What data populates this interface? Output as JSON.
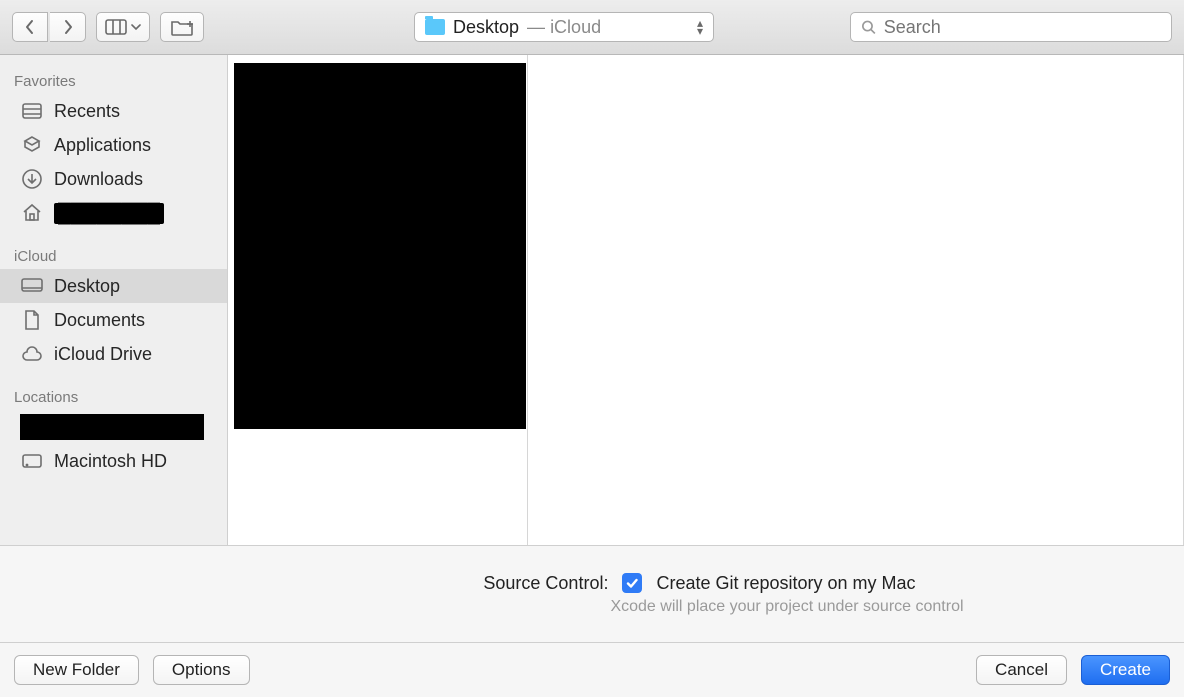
{
  "toolbar": {
    "path": {
      "name": "Desktop",
      "location": "iCloud"
    },
    "search_placeholder": "Search"
  },
  "sidebar": {
    "sections": [
      {
        "title": "Favorites",
        "items": [
          {
            "id": "recents",
            "label": "Recents",
            "icon": "recents"
          },
          {
            "id": "applications",
            "label": "Applications",
            "icon": "applications"
          },
          {
            "id": "downloads",
            "label": "Downloads",
            "icon": "downloads"
          },
          {
            "id": "home-hidden",
            "label": "",
            "icon": "house",
            "label_redacted": true
          }
        ]
      },
      {
        "title": "iCloud",
        "items": [
          {
            "id": "desktop",
            "label": "Desktop",
            "icon": "desktop",
            "selected": true
          },
          {
            "id": "documents",
            "label": "Documents",
            "icon": "document"
          },
          {
            "id": "icloud",
            "label": "iCloud Drive",
            "icon": "cloud"
          }
        ]
      },
      {
        "title": "Locations",
        "leading_redacted_block": true,
        "items": [
          {
            "id": "macintosh-hd",
            "label": "Macintosh HD",
            "icon": "hdd"
          }
        ]
      }
    ]
  },
  "options": {
    "label": "Source Control:",
    "checkbox_checked": true,
    "checkbox_label": "Create Git repository on my Mac",
    "subtext": "Xcode will place your project under source control"
  },
  "footer": {
    "new_folder": "New Folder",
    "options": "Options",
    "cancel": "Cancel",
    "create": "Create"
  }
}
